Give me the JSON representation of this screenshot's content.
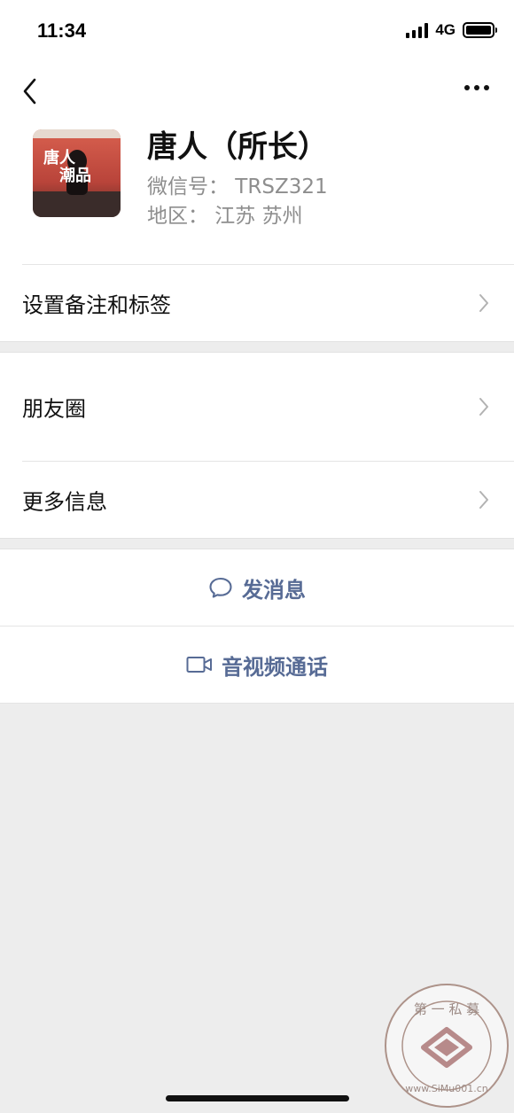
{
  "status_bar": {
    "time": "11:34",
    "network": "4G",
    "battery_level": 1.0
  },
  "nav": {
    "back_icon": "chevron-left-icon",
    "more_icon": "more-dots-icon"
  },
  "profile": {
    "name": "唐人（所长）",
    "wechat_id": "微信号：  TRSZ321",
    "region": "地区：  江苏 苏州",
    "avatar_text_top": "唐人",
    "avatar_text_bottom": "潮品"
  },
  "menu": {
    "remarks_tags": "设置备注和标签",
    "moments": "朋友圈",
    "more_info": "更多信息"
  },
  "actions": {
    "message": "发消息",
    "video_call": "音视频通话",
    "accent_color": "#576b95"
  },
  "watermark": {
    "top_text": "第 一 私 募",
    "bottom_text": "www.SiMu001.cn"
  }
}
